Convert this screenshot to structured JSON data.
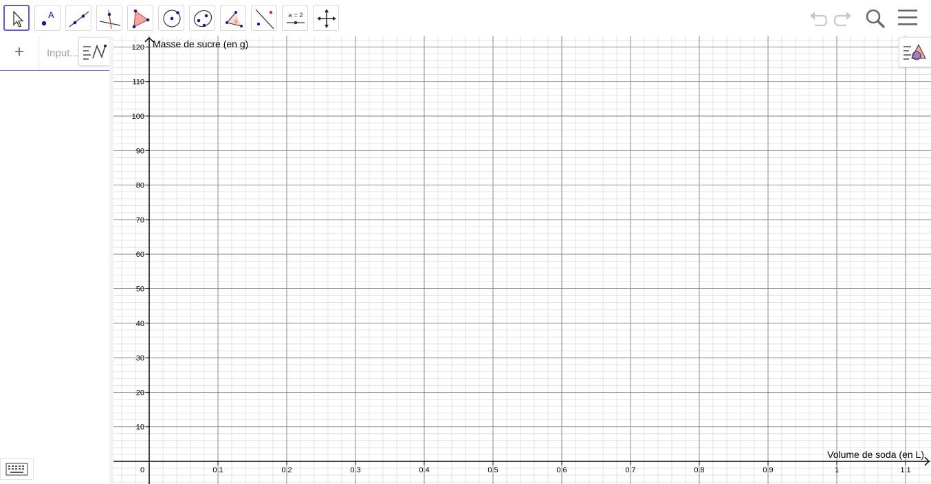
{
  "toolbar": {
    "tools": [
      {
        "name": "move-tool",
        "icon": "cursor-arrow-icon"
      },
      {
        "name": "point-tool",
        "icon": "point-icon",
        "label": "A"
      },
      {
        "name": "line-tool",
        "icon": "line-icon"
      },
      {
        "name": "perpendicular-line-tool",
        "icon": "perpendicular-icon"
      },
      {
        "name": "polygon-tool",
        "icon": "polygon-icon"
      },
      {
        "name": "circle-center-point-tool",
        "icon": "circle-icon"
      },
      {
        "name": "ellipse-tool",
        "icon": "ellipse-icon"
      },
      {
        "name": "angle-tool",
        "icon": "angle-icon",
        "label": "α"
      },
      {
        "name": "reflect-tool",
        "icon": "reflect-icon"
      },
      {
        "name": "slider-tool",
        "icon": "slider-icon",
        "label": "a = 2"
      },
      {
        "name": "move-graphics-tool",
        "icon": "move-arrows-icon"
      }
    ],
    "right_icons": [
      "undo-icon",
      "redo-icon",
      "search-icon",
      "menu-icon"
    ]
  },
  "algebra": {
    "plus_label": "+",
    "input_placeholder": "Input..."
  },
  "chart_data": {
    "type": "scatter",
    "xlabel": "Volume de soda (en L)",
    "ylabel": "Masse de sucre (en g)",
    "xlim": [
      -0.05,
      1.13
    ],
    "ylim": [
      -6,
      122
    ],
    "x_ticks": [
      0.1,
      0.2,
      0.3,
      0.4,
      0.5,
      0.6,
      0.7,
      0.8,
      0.9,
      1,
      1.1
    ],
    "x_tick_labels": [
      "0.1",
      "0.2",
      "0.3",
      "0.4",
      "0.5",
      "0.6",
      "0.7",
      "0.8",
      "0.9",
      "1",
      "1.1"
    ],
    "y_ticks": [
      10,
      20,
      30,
      40,
      50,
      60,
      70,
      80,
      90,
      100,
      110,
      120
    ],
    "y_tick_labels": [
      "10",
      "20",
      "30",
      "40",
      "50",
      "60",
      "70",
      "80",
      "90",
      "100",
      "110",
      "120"
    ],
    "origin_label": "0",
    "grid": true,
    "major_x_step": 0.1,
    "major_y_step": 10,
    "minor_x_step": 0.02,
    "minor_y_step": 2,
    "series": []
  },
  "colors": {
    "accent": "#6557d2",
    "point": "#1a1a8c",
    "polygon_fill": "#f4a6a6",
    "major_grid": "#808080",
    "minor_grid": "#d8d8d8",
    "axis": "#000000"
  }
}
